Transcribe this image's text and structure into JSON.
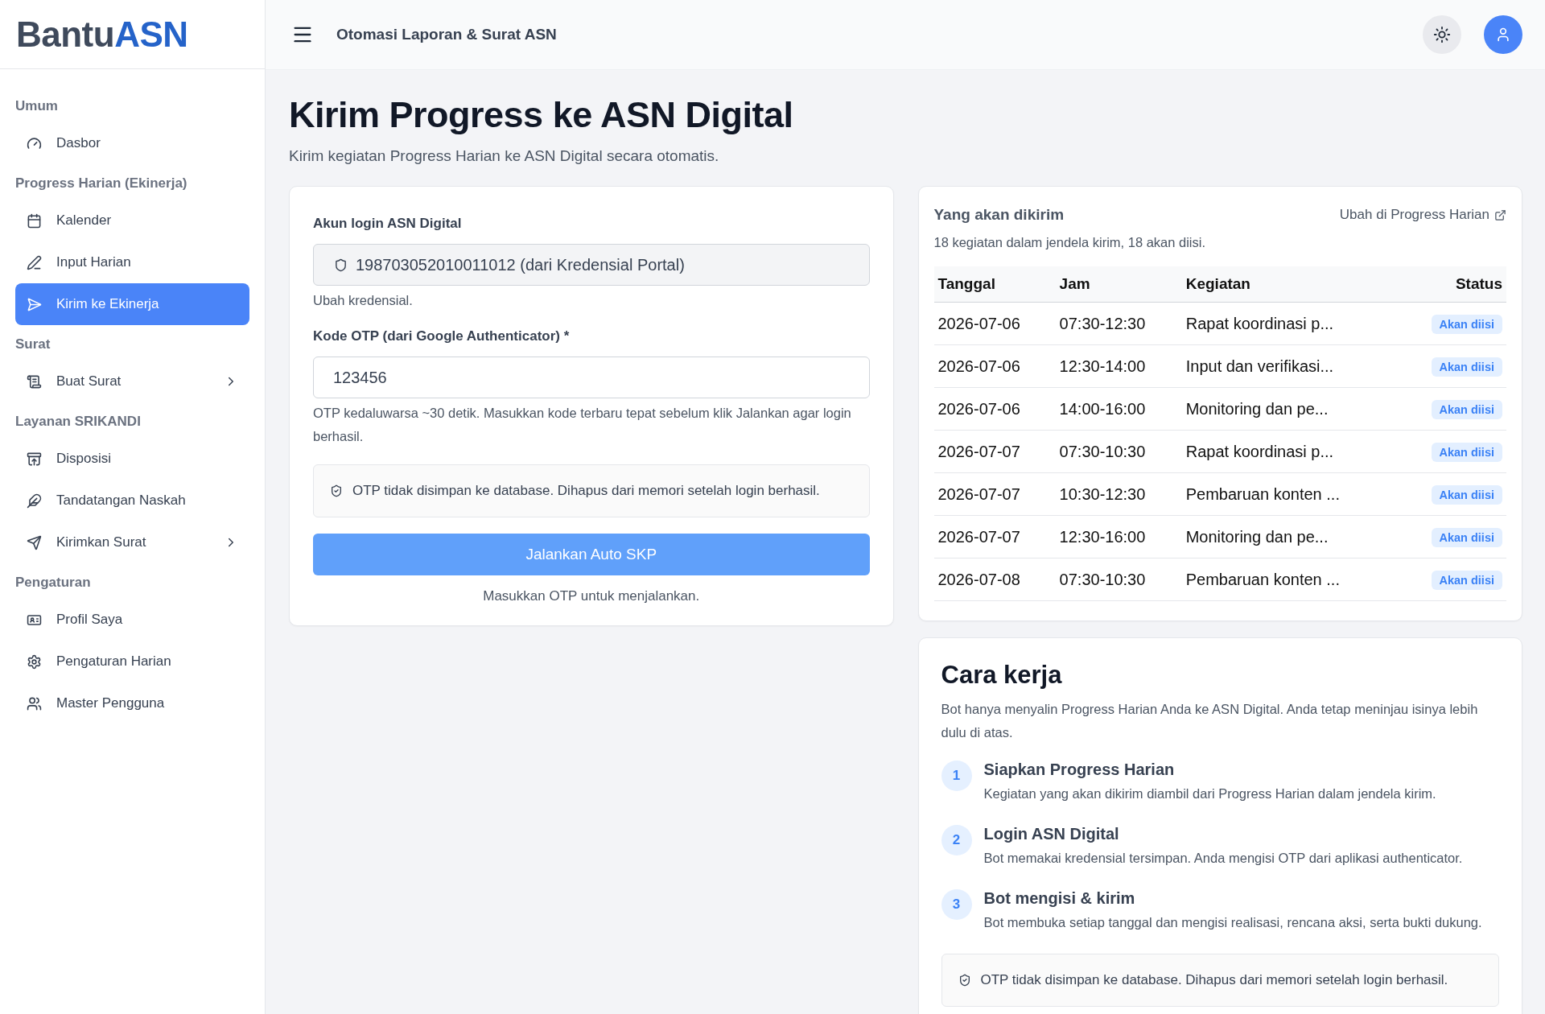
{
  "brand": {
    "prefix": "Bantu",
    "accent": "ASN"
  },
  "header": {
    "title": "Otomasi Laporan & Surat ASN"
  },
  "sidebar": {
    "sections": [
      {
        "label": "Umum",
        "items": [
          {
            "label": "Dasbor",
            "selected": false,
            "expandable": false
          }
        ]
      },
      {
        "label": "Progress Harian (Ekinerja)",
        "items": [
          {
            "label": "Kalender",
            "selected": false,
            "expandable": false
          },
          {
            "label": "Input Harian",
            "selected": false,
            "expandable": false
          },
          {
            "label": "Kirim ke Ekinerja",
            "selected": true,
            "expandable": false
          }
        ]
      },
      {
        "label": "Surat",
        "items": [
          {
            "label": "Buat Surat",
            "selected": false,
            "expandable": true
          }
        ]
      },
      {
        "label": "Layanan SRIKANDI",
        "items": [
          {
            "label": "Disposisi",
            "selected": false,
            "expandable": false
          },
          {
            "label": "Tandatangan Naskah",
            "selected": false,
            "expandable": false
          },
          {
            "label": "Kirimkan Surat",
            "selected": false,
            "expandable": true
          }
        ]
      },
      {
        "label": "Pengaturan",
        "items": [
          {
            "label": "Profil Saya",
            "selected": false,
            "expandable": false
          },
          {
            "label": "Pengaturan Harian",
            "selected": false,
            "expandable": false
          },
          {
            "label": "Master Pengguna",
            "selected": false,
            "expandable": false
          }
        ]
      }
    ]
  },
  "page": {
    "title": "Kirim Progress ke ASN Digital",
    "subtitle": "Kirim kegiatan Progress Harian ke ASN Digital secara otomatis."
  },
  "form": {
    "account_label": "Akun login ASN Digital",
    "account_value": "198703052010011012 (dari Kredensial Portal)",
    "account_hint": "Ubah kredensial.",
    "otp_label": "Kode OTP (dari Google Authenticator) *",
    "otp_value": "123456",
    "otp_hint": "OTP kedaluwarsa ~30 detik. Masukkan kode terbaru tepat sebelum klik Jalankan agar login berhasil.",
    "note": "OTP tidak disimpan ke database. Dihapus dari memori setelah login berhasil.",
    "button": "Jalankan Auto SKP",
    "button_disabled": true,
    "footer": "Masukkan OTP untuk menjalankan."
  },
  "queue": {
    "title": "Yang akan dikirim",
    "link": "Ubah di Progress Harian",
    "summary": "18 kegiatan dalam jendela kirim, 18 akan diisi.",
    "columns": [
      "Tanggal",
      "Jam",
      "Kegiatan",
      "Status"
    ],
    "rows": [
      [
        "2026-07-06",
        "07:30-12:30",
        "Rapat koordinasi p...",
        "Akan diisi"
      ],
      [
        "2026-07-06",
        "12:30-14:00",
        "Input dan verifikasi...",
        "Akan diisi"
      ],
      [
        "2026-07-06",
        "14:00-16:00",
        "Monitoring dan pe...",
        "Akan diisi"
      ],
      [
        "2026-07-07",
        "07:30-10:30",
        "Rapat koordinasi p...",
        "Akan diisi"
      ],
      [
        "2026-07-07",
        "10:30-12:30",
        "Pembaruan konten ...",
        "Akan diisi"
      ],
      [
        "2026-07-07",
        "12:30-16:00",
        "Monitoring dan pe...",
        "Akan diisi"
      ],
      [
        "2026-07-08",
        "07:30-10:30",
        "Pembaruan konten ...",
        "Akan diisi"
      ]
    ]
  },
  "how": {
    "title": "Cara kerja",
    "intro": "Bot hanya menyalin Progress Harian Anda ke ASN Digital. Anda tetap meninjau isinya lebih dulu di atas.",
    "steps": [
      {
        "number": "1",
        "title": "Siapkan Progress Harian",
        "text": "Kegiatan yang akan dikirim diambil dari Progress Harian dalam jendela kirim."
      },
      {
        "number": "2",
        "title": "Login ASN Digital",
        "text": "Bot memakai kredensial tersimpan. Anda mengisi OTP dari aplikasi authenticator."
      },
      {
        "number": "3",
        "title": "Bot mengisi & kirim",
        "text": "Bot membuka setiap tanggal dan mengisi realisasi, rencana aksi, serta bukti dukung."
      }
    ],
    "note": "OTP tidak disimpan ke database. Dihapus dari memori setelah login berhasil."
  }
}
